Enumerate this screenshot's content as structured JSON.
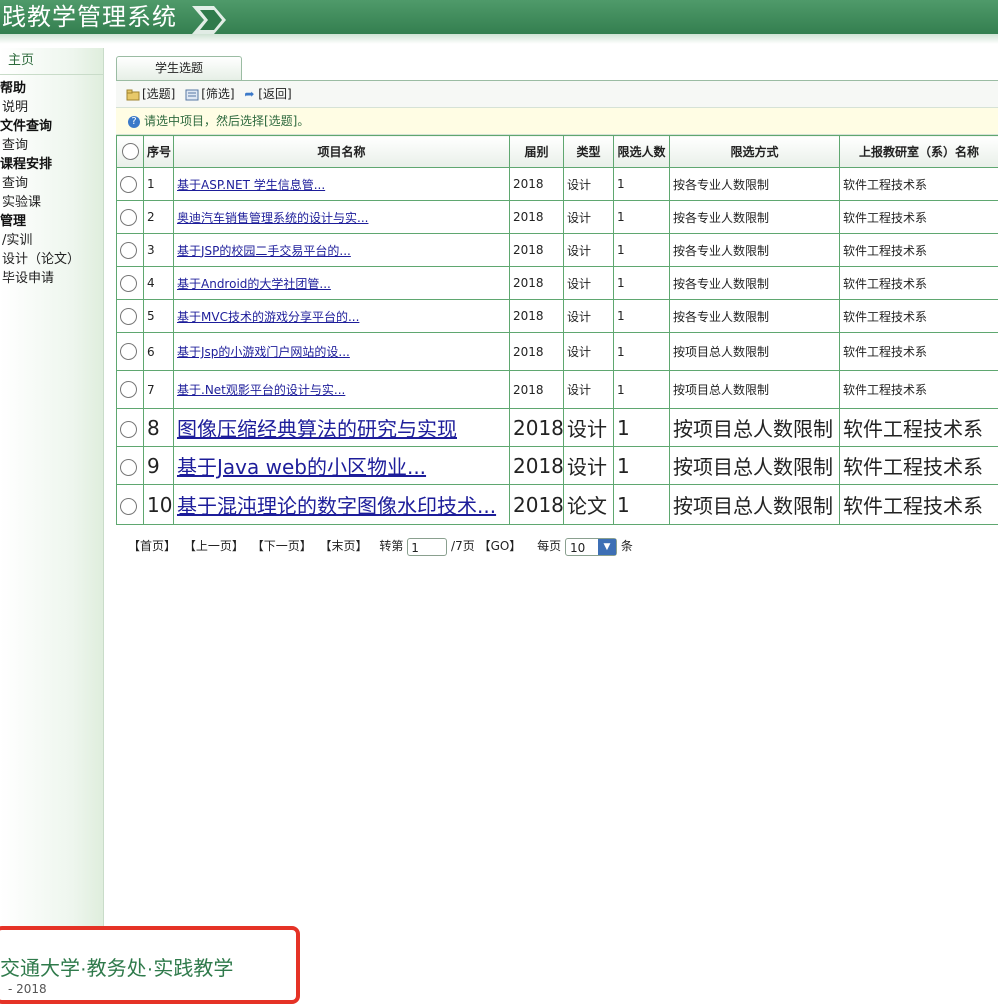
{
  "header": {
    "title": "践教学管理系统"
  },
  "sidebar": {
    "home": "主页",
    "items": [
      {
        "label": "帮助",
        "section": true
      },
      {
        "label": "说明",
        "section": false
      },
      {
        "label": "文件查询",
        "section": true
      },
      {
        "label": "查询",
        "section": false
      },
      {
        "label": "课程安排",
        "section": true
      },
      {
        "label": "查询",
        "section": false
      },
      {
        "label": "实验课",
        "section": false
      },
      {
        "label": "管理",
        "section": true
      },
      {
        "label": "/实训",
        "section": false
      },
      {
        "label": "设计（论文）",
        "section": false
      },
      {
        "label": "毕设申请",
        "section": false
      }
    ]
  },
  "main": {
    "tab": "学生选题",
    "toolbar": {
      "select": "[选题]",
      "filter": "[筛选]",
      "back": "[返回]"
    },
    "notice": "请选中项目，然后选择[选题]。",
    "columns": [
      "序号",
      "项目名称",
      "届别",
      "类型",
      "限选人数",
      "限选方式",
      "上报教研室（系）名称"
    ],
    "rows": [
      {
        "no": "1",
        "name": "基于ASP.NET 学生信息管...",
        "year": "2018",
        "type": "设计",
        "limit": "1",
        "mode": "按各专业人数限制",
        "dept": "软件工程技术系"
      },
      {
        "no": "2",
        "name": "奥迪汽车销售管理系统的设计与实...",
        "year": "2018",
        "type": "设计",
        "limit": "1",
        "mode": "按各专业人数限制",
        "dept": "软件工程技术系"
      },
      {
        "no": "3",
        "name": "基于JSP的校园二手交易平台的...",
        "year": "2018",
        "type": "设计",
        "limit": "1",
        "mode": "按各专业人数限制",
        "dept": "软件工程技术系"
      },
      {
        "no": "4",
        "name": "基于Android的大学社团管...",
        "year": "2018",
        "type": "设计",
        "limit": "1",
        "mode": "按各专业人数限制",
        "dept": "软件工程技术系"
      },
      {
        "no": "5",
        "name": "基于MVC技术的游戏分享平台的...",
        "year": "2018",
        "type": "设计",
        "limit": "1",
        "mode": "按各专业人数限制",
        "dept": "软件工程技术系"
      },
      {
        "no": "6",
        "name": "基于Jsp的小游戏门户网站的设...",
        "year": "2018",
        "type": "设计",
        "limit": "1",
        "mode": "按项目总人数限制",
        "dept": "软件工程技术系"
      },
      {
        "no": "7",
        "name": "基于.Net观影平台的设计与实...",
        "year": "2018",
        "type": "设计",
        "limit": "1",
        "mode": "按项目总人数限制",
        "dept": "软件工程技术系"
      },
      {
        "no": "8",
        "name": "图像压缩经典算法的研究与实现",
        "year": "2018",
        "type": "设计",
        "limit": "1",
        "mode": "按项目总人数限制",
        "dept": "软件工程技术系"
      },
      {
        "no": "9",
        "name": "基于Java web的小区物业...",
        "year": "2018",
        "type": "设计",
        "limit": "1",
        "mode": "按项目总人数限制",
        "dept": "软件工程技术系"
      },
      {
        "no": "10",
        "name": "基于混沌理论的数字图像水印技术...",
        "year": "2018",
        "type": "论文",
        "limit": "1",
        "mode": "按项目总人数限制",
        "dept": "软件工程技术系"
      }
    ],
    "pager": {
      "first": "【首页】",
      "prev": "【上一页】",
      "next": "【下一页】",
      "last": "【末页】",
      "goto_label": "转第",
      "goto_value": "1",
      "total": "/7页",
      "go": "【GO】",
      "per_page_label": "每页",
      "per_page_value": "10",
      "per_page_unit": "条"
    }
  },
  "footer": {
    "school": "交通大学·教务处·实践教学",
    "year": "- 2018"
  },
  "colors": {
    "brand": "#2f7a4b",
    "grid_border": "#5fa770",
    "link": "#1d1d9a",
    "highlight": "#e53226"
  }
}
